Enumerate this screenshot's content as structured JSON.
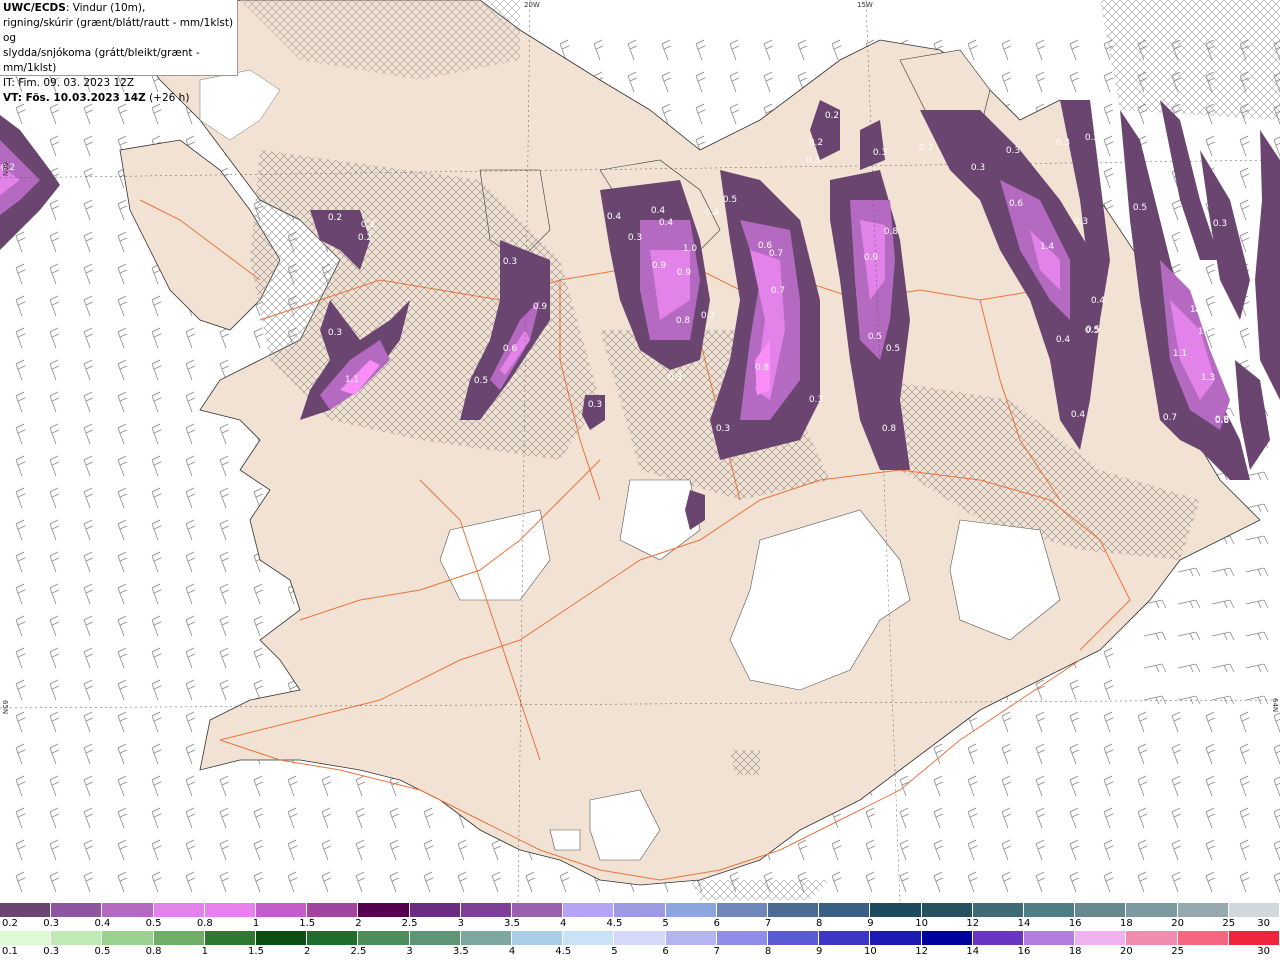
{
  "header": {
    "line1_bold": "UWC/ECDS",
    "line1_rest": ": Vindur (10m),",
    "line2": "rigning/skúrir (grænt/blátt/rautt - mm/1klst) og",
    "line3": "slydda/snjókoma (grátt/bleikt/grænt - mm/1klst)",
    "line4": "IT: Fim. 09. 03. 2023 12Z",
    "line5_bold": "VT: Fös. 10.03.2023 14Z",
    "line5_rest": " (+26 h)"
  },
  "grid_labels": {
    "lon_20w": "20W",
    "lon_15w": "15W",
    "lat_left": "65N",
    "lat_right": "64N",
    "lat_left2": "66N"
  },
  "colors": {
    "sea": "#ffffff",
    "land": "#f1e2d3",
    "glacier": "#ffffff",
    "roads": "#e9743e",
    "precip_levels": [
      "#6a4570",
      "#8c4f99",
      "#b56ac1",
      "#e383e9",
      "#f98ef9"
    ]
  },
  "precip_labels": [
    "0.2",
    "0.2",
    "0.2",
    "0.2",
    "0.2",
    "0.3",
    "0.2",
    "0.3",
    "0.4",
    "0.4",
    "0.3",
    "0.3",
    "0.5",
    "0.3",
    "0.3",
    "0.6",
    "0.4",
    "0.4",
    "0.9",
    "0.9",
    "1.0",
    "0.9",
    "1.1",
    "0.3",
    "0.8",
    "0.3",
    "0.5",
    "0.8",
    "0.6",
    "0.7",
    "0.7",
    "0.8",
    "1.1",
    "0.5",
    "0.3",
    "0.9",
    "0.8",
    "0.5",
    "0.3",
    "0.3",
    "1.4",
    "0.5",
    "0.4",
    "0.4",
    "0.5",
    "0.6",
    "1.2",
    "1.0",
    "1.1",
    "1.3",
    "0.7",
    "0.8",
    "0.4",
    "0.3",
    "0.3",
    "0.3",
    "0.6",
    "0.8",
    "0.3",
    "0.3",
    "0.5",
    "0.2"
  ],
  "legend_snow": {
    "labels": [
      "0.2",
      "0.3",
      "0.4",
      "0.5",
      "0.8",
      "1",
      "1.5",
      "2",
      "2.5",
      "3",
      "3.5",
      "4",
      "4.5",
      "5",
      "6",
      "7",
      "8",
      "9",
      "10",
      "12",
      "14",
      "16",
      "18",
      "20",
      "25",
      "30"
    ],
    "colors": [
      "#6a4570",
      "#8e56a0",
      "#b56ac1",
      "#e383e9",
      "#e980ec",
      "#c35dc9",
      "#a0469f",
      "#54004f",
      "#6b2b80",
      "#7e3f96",
      "#9a60b0",
      "#b4a4f3",
      "#9d9ae2",
      "#8aa6dc",
      "#6f86b8",
      "#4b6b93",
      "#385f84",
      "#1c4a5e",
      "#26515e",
      "#3e6b75",
      "#4f7e86",
      "#68898f",
      "#7c9aa0",
      "#95aab0",
      "#d2d7dc"
    ]
  },
  "legend_rain": {
    "labels": [
      "0.1",
      "0.3",
      "0.5",
      "0.8",
      "1",
      "1.5",
      "2",
      "2.5",
      "3",
      "3.5",
      "4",
      "4.5",
      "5",
      "6",
      "7",
      "8",
      "9",
      "10",
      "12",
      "14",
      "16",
      "18",
      "20",
      "25",
      "30"
    ],
    "colors": [
      "#dcfbd4",
      "#bfeab6",
      "#99d18e",
      "#6fae66",
      "#2d7a30",
      "#0d4f12",
      "#1f6e2e",
      "#4d8e5a",
      "#5e9577",
      "#7da8a0",
      "#a8cfe7",
      "#c8e3f5",
      "#d5d7fb",
      "#b3b5f3",
      "#8f8ce8",
      "#5c5bd6",
      "#3c37c4",
      "#1c1ab0",
      "#00009e",
      "#6b35c4",
      "#b27ce0",
      "#f0b1f0",
      "#ef8cb0",
      "#f4677e",
      "#f0243a"
    ]
  }
}
